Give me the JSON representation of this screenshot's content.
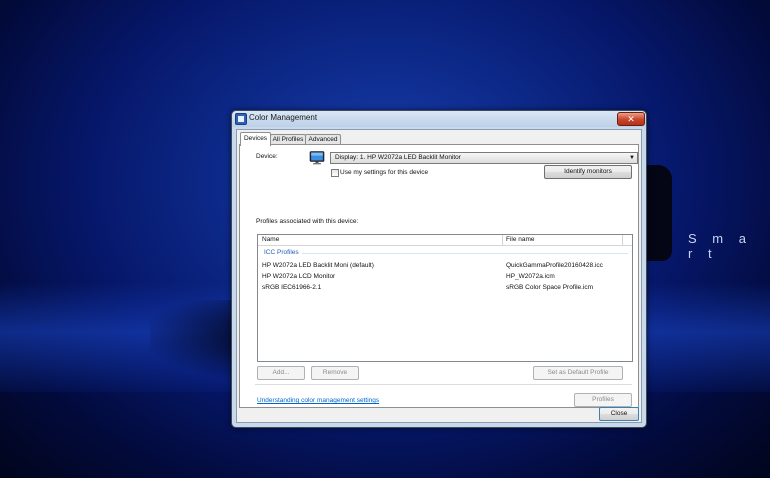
{
  "background": {
    "brand_text": "S m a r t"
  },
  "window": {
    "title": "Color Management",
    "close_glyph": "✕",
    "tabs": [
      {
        "label": "Devices",
        "active": true
      },
      {
        "label": "All Profiles",
        "active": false
      },
      {
        "label": "Advanced",
        "active": false
      }
    ],
    "device": {
      "label": "Device:",
      "selected": "Display: 1. HP W2072a LED Backlit Monitor",
      "use_settings_label": "Use my settings for this device",
      "use_settings_checked": false,
      "identify_button": "Identify monitors"
    },
    "profiles": {
      "heading": "Profiles associated with this device:",
      "columns": [
        "Name",
        "File name"
      ],
      "group_label": "ICC Profiles",
      "rows": [
        {
          "name": "HP W2072a LED Backlit Moni (default)",
          "file": "QuickGammaProfile20160428.icc"
        },
        {
          "name": "HP W2072a LCD Monitor",
          "file": "HP_W2072a.icm"
        },
        {
          "name": "sRGB IEC61966-2.1",
          "file": "sRGB Color Space Profile.icm"
        }
      ]
    },
    "buttons": {
      "add": "Add...",
      "remove": "Remove",
      "set_default": "Set as Default Profile",
      "profiles": "Profiles",
      "close": "Close"
    },
    "help_link": "Understanding color management settings"
  },
  "colors": {
    "link": "#0066cc",
    "group_label": "#1e5fb4",
    "desktop_accent": "#1a3fb0"
  },
  "icons": {
    "app": "color-management-icon",
    "device": "monitor-icon",
    "dropdown": "chevron-down-icon"
  }
}
